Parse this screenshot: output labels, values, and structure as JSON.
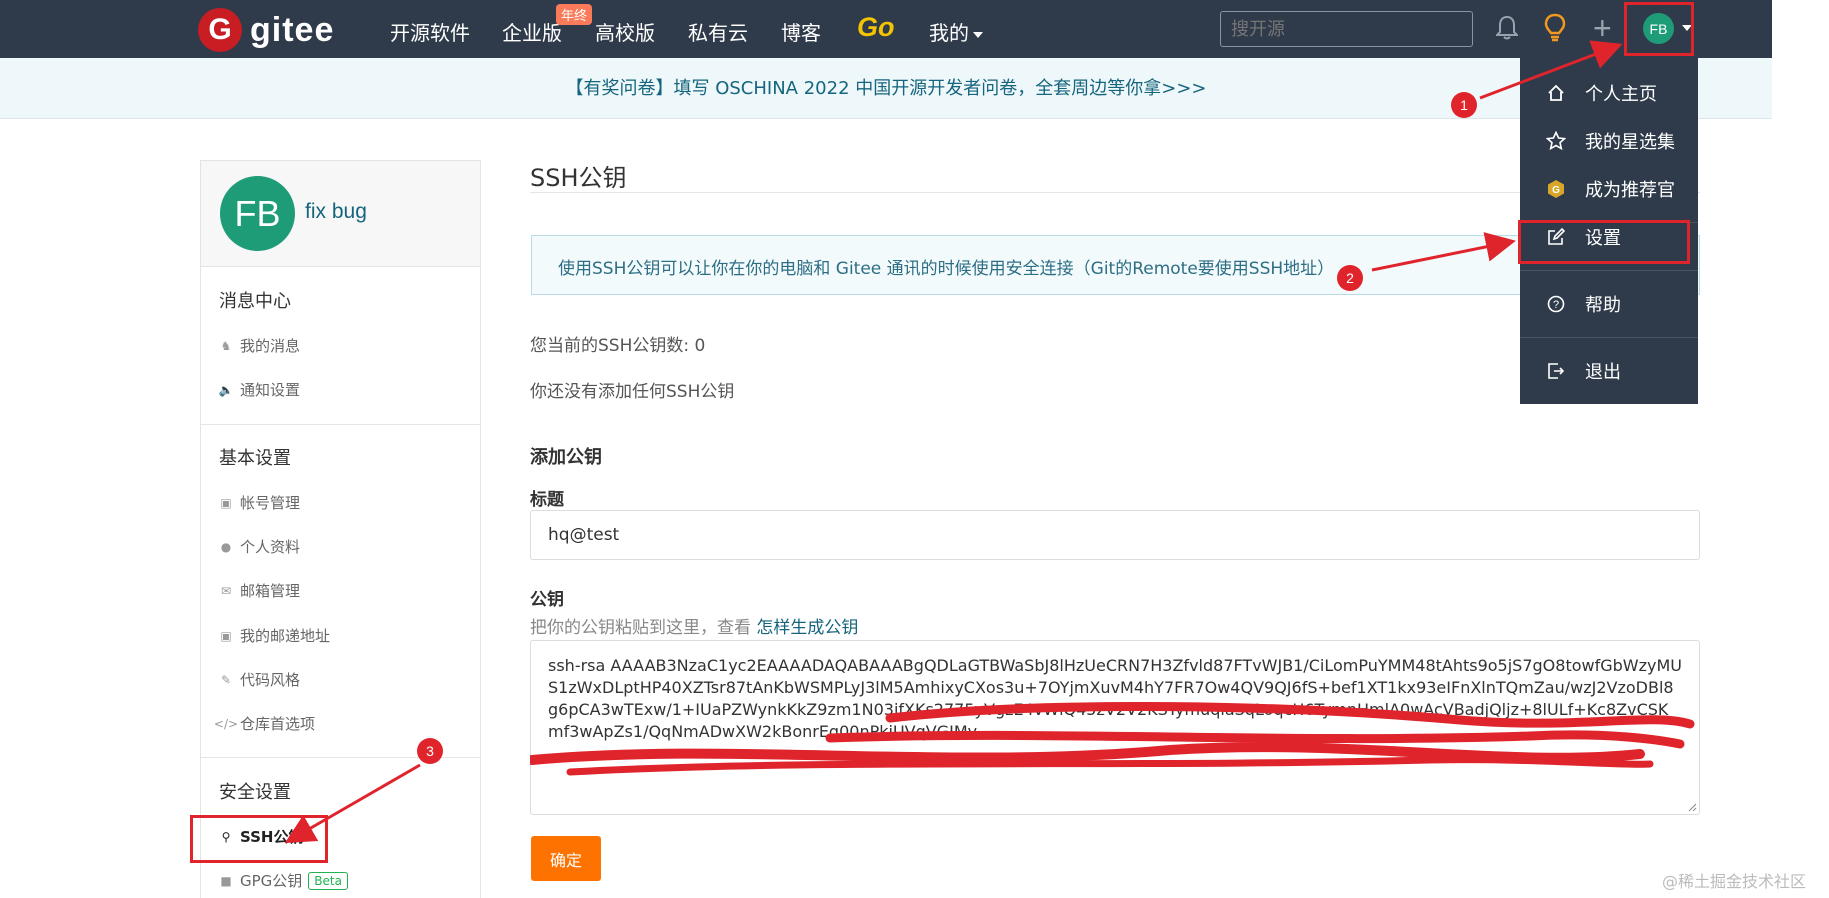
{
  "colors": {
    "nav_bg": "#2f3b4a",
    "brand_red": "#c71d23",
    "accent_orange": "#fe7300",
    "link_teal": "#16657e",
    "avatar_green": "#1e9c78",
    "annotation_red": "#e0242c"
  },
  "nav": {
    "logo_text": "gitee",
    "items": [
      "开源软件",
      "企业版",
      "高校版",
      "私有云",
      "博客"
    ],
    "enterprise_badge": "年终",
    "go_label": "Go",
    "mine_label": "我的",
    "search_placeholder": "搜开源",
    "avatar_initials": "FB",
    "icons": [
      "bell-icon",
      "lightbulb-icon",
      "plus-icon"
    ]
  },
  "announcement": "【有奖问卷】填写 OSCHINA 2022 中国开源开发者问卷，全套周边等你拿>>>",
  "sidebar": {
    "avatar_initials": "FB",
    "user_name": "fix bug",
    "sections": [
      {
        "title": "消息中心",
        "items": [
          {
            "label": "我的消息",
            "icon": "bell-icon"
          },
          {
            "label": "通知设置",
            "icon": "speaker-icon"
          }
        ]
      },
      {
        "title": "基本设置",
        "items": [
          {
            "label": "帐号管理",
            "icon": "id-card-icon"
          },
          {
            "label": "个人资料",
            "icon": "user-icon"
          },
          {
            "label": "邮箱管理",
            "icon": "envelope-icon"
          },
          {
            "label": "我的邮递地址",
            "icon": "address-card-icon"
          },
          {
            "label": "代码风格",
            "icon": "brush-icon"
          },
          {
            "label": "仓库首选项",
            "icon": "code-icon"
          }
        ]
      },
      {
        "title": "安全设置",
        "items": [
          {
            "label": "SSH公钥",
            "icon": "key-icon",
            "active": true
          },
          {
            "label": "GPG公钥",
            "icon": "lock-icon",
            "badge": "Beta"
          }
        ]
      }
    ]
  },
  "main": {
    "title": "SSH公钥",
    "info": "使用SSH公钥可以让你在你的电脑和 Gitee 通讯的时候使用安全连接（Git的Remote要使用SSH地址）",
    "key_count": "您当前的SSH公钥数: 0",
    "no_key": "你还没有添加任何SSH公钥",
    "add_heading": "添加公钥",
    "title_label": "标题",
    "title_value": "hq@test",
    "key_label": "公钥",
    "key_hint": "把你的公钥粘贴到这里，查看",
    "key_hint_link": "怎样生成公钥",
    "key_value": "ssh-rsa AAAAB3NzaC1yc2EAAAADAQABAAABgQDLaGTBWaSbJ8lHzUeCRN7H3Zfvld87FTvWJB1/CiLomPuYMM48tAhts9o5jS7gO8towfGbWzyMUS1zWxDLptHP40XZTsr87tAnKbWSMPLyJ3lM5AmhixyCXos3u+7OYjmXuvM4hY7FR7Ow4QV9QJ6fS+bef1XT1kx93eIFnXlnTQmZau/wzJ2VzoDBl8g6pCA3wTExw/1+IUaPZWynkKkZ9zm1N03jfXKs2775yVgzE4vWlQ45zV2V2KSTymuqiaSqLoqcH6TymnHmlA0wAcVBadjQljz+8lULf+Kc8ZvCSKmf3wApZs1/QqNmADwXW2kBonrEq00nPkjUVqVGIMv",
    "confirm_button": "确定"
  },
  "dropdown": {
    "items": [
      {
        "label": "个人主页",
        "icon": "home-icon"
      },
      {
        "label": "我的星选集",
        "icon": "star-icon"
      },
      {
        "label": "成为推荐官",
        "icon": "gitee-badge-icon"
      },
      {
        "label": "设置",
        "icon": "edit-icon"
      },
      {
        "label": "帮助",
        "icon": "help-icon"
      },
      {
        "label": "退出",
        "icon": "logout-icon"
      }
    ]
  },
  "annotations": {
    "steps": [
      "1",
      "2",
      "3"
    ]
  },
  "watermark": "@稀土掘金技术社区"
}
